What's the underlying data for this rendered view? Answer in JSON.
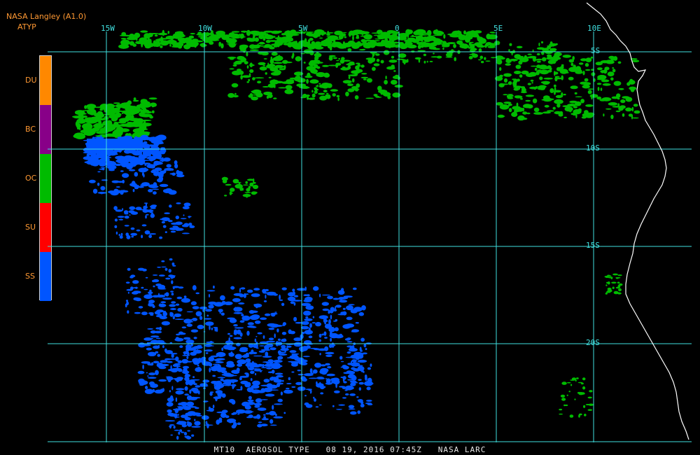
{
  "header": {
    "source": "NASA Langley (A1.0)",
    "product_code": "ATYP"
  },
  "legend": {
    "items": [
      {
        "label": "DU",
        "color": "#ff8800"
      },
      {
        "label": "BC",
        "color": "#880088"
      },
      {
        "label": "OC",
        "color": "#00bb00"
      },
      {
        "label": "SU",
        "color": "#ff0000"
      },
      {
        "label": "SS",
        "color": "#0055ff"
      }
    ]
  },
  "map": {
    "grid_color": "#40e0e0",
    "coast_color": "#ffffff",
    "longitude_labels": [
      "15W",
      "10W",
      "5W",
      "0",
      "5E",
      "10E"
    ],
    "latitude_labels": [
      "5S",
      "10S",
      "15S",
      "20S"
    ]
  },
  "footer": {
    "caption": "MT10  AEROSOL TYPE   08 19, 2016 07:45Z   NASA LARC"
  }
}
